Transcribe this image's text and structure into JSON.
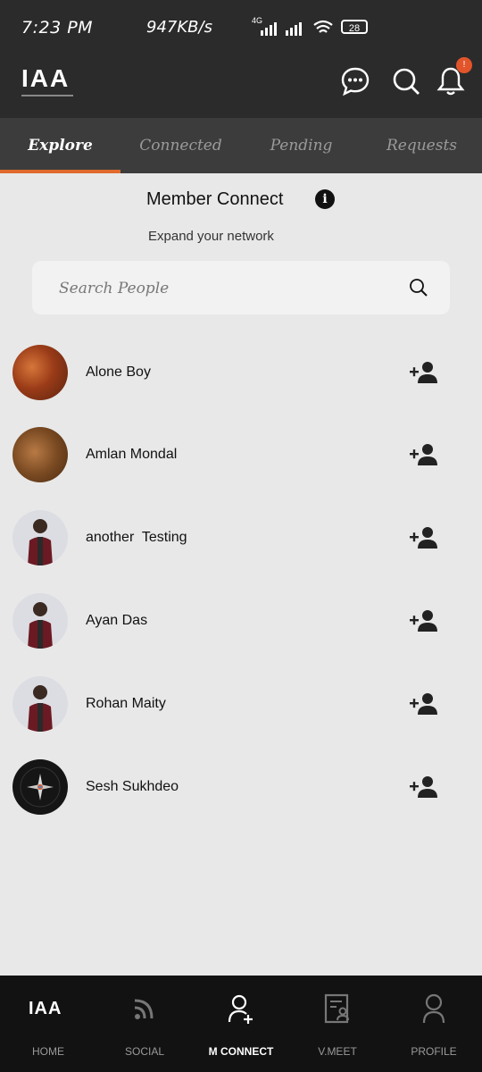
{
  "status_bar": {
    "time": "7:23 PM",
    "speed": "947KB/s",
    "network": "4G",
    "battery": "28"
  },
  "app": {
    "logo_text": "IAA",
    "notification_badge": "!"
  },
  "tabs": [
    {
      "label": "Explore",
      "active": true
    },
    {
      "label": "Connected",
      "active": false
    },
    {
      "label": "Pending",
      "active": false
    },
    {
      "label": "Requests",
      "active": false
    }
  ],
  "header": {
    "title": "Member Connect",
    "subtitle": "Expand your network"
  },
  "search": {
    "placeholder": "Search People"
  },
  "members": [
    {
      "name": "Alone Boy",
      "avatar": "food"
    },
    {
      "name": "Amlan Mondal",
      "avatar": "food"
    },
    {
      "name": "another  Testing",
      "avatar": "person"
    },
    {
      "name": "Ayan Das",
      "avatar": "person"
    },
    {
      "name": "Rohan Maity",
      "avatar": "person"
    },
    {
      "name": "Sesh Sukhdeo",
      "avatar": "compass"
    }
  ],
  "bottom_nav": [
    {
      "label": "HOME",
      "icon": "iaa-logo-icon",
      "active": false
    },
    {
      "label": "SOCIAL",
      "icon": "rss-icon",
      "active": false
    },
    {
      "label": "M CONNECT",
      "icon": "add-user-icon",
      "active": true
    },
    {
      "label": "V.MEET",
      "icon": "document-user-icon",
      "active": false
    },
    {
      "label": "PROFILE",
      "icon": "user-icon",
      "active": false
    }
  ],
  "colors": {
    "accent": "#e06a2c",
    "header_bg": "#2b2b2b",
    "tab_bg": "#3c3c3c",
    "page_bg": "#e8e8e8",
    "nav_bg": "#121212"
  }
}
